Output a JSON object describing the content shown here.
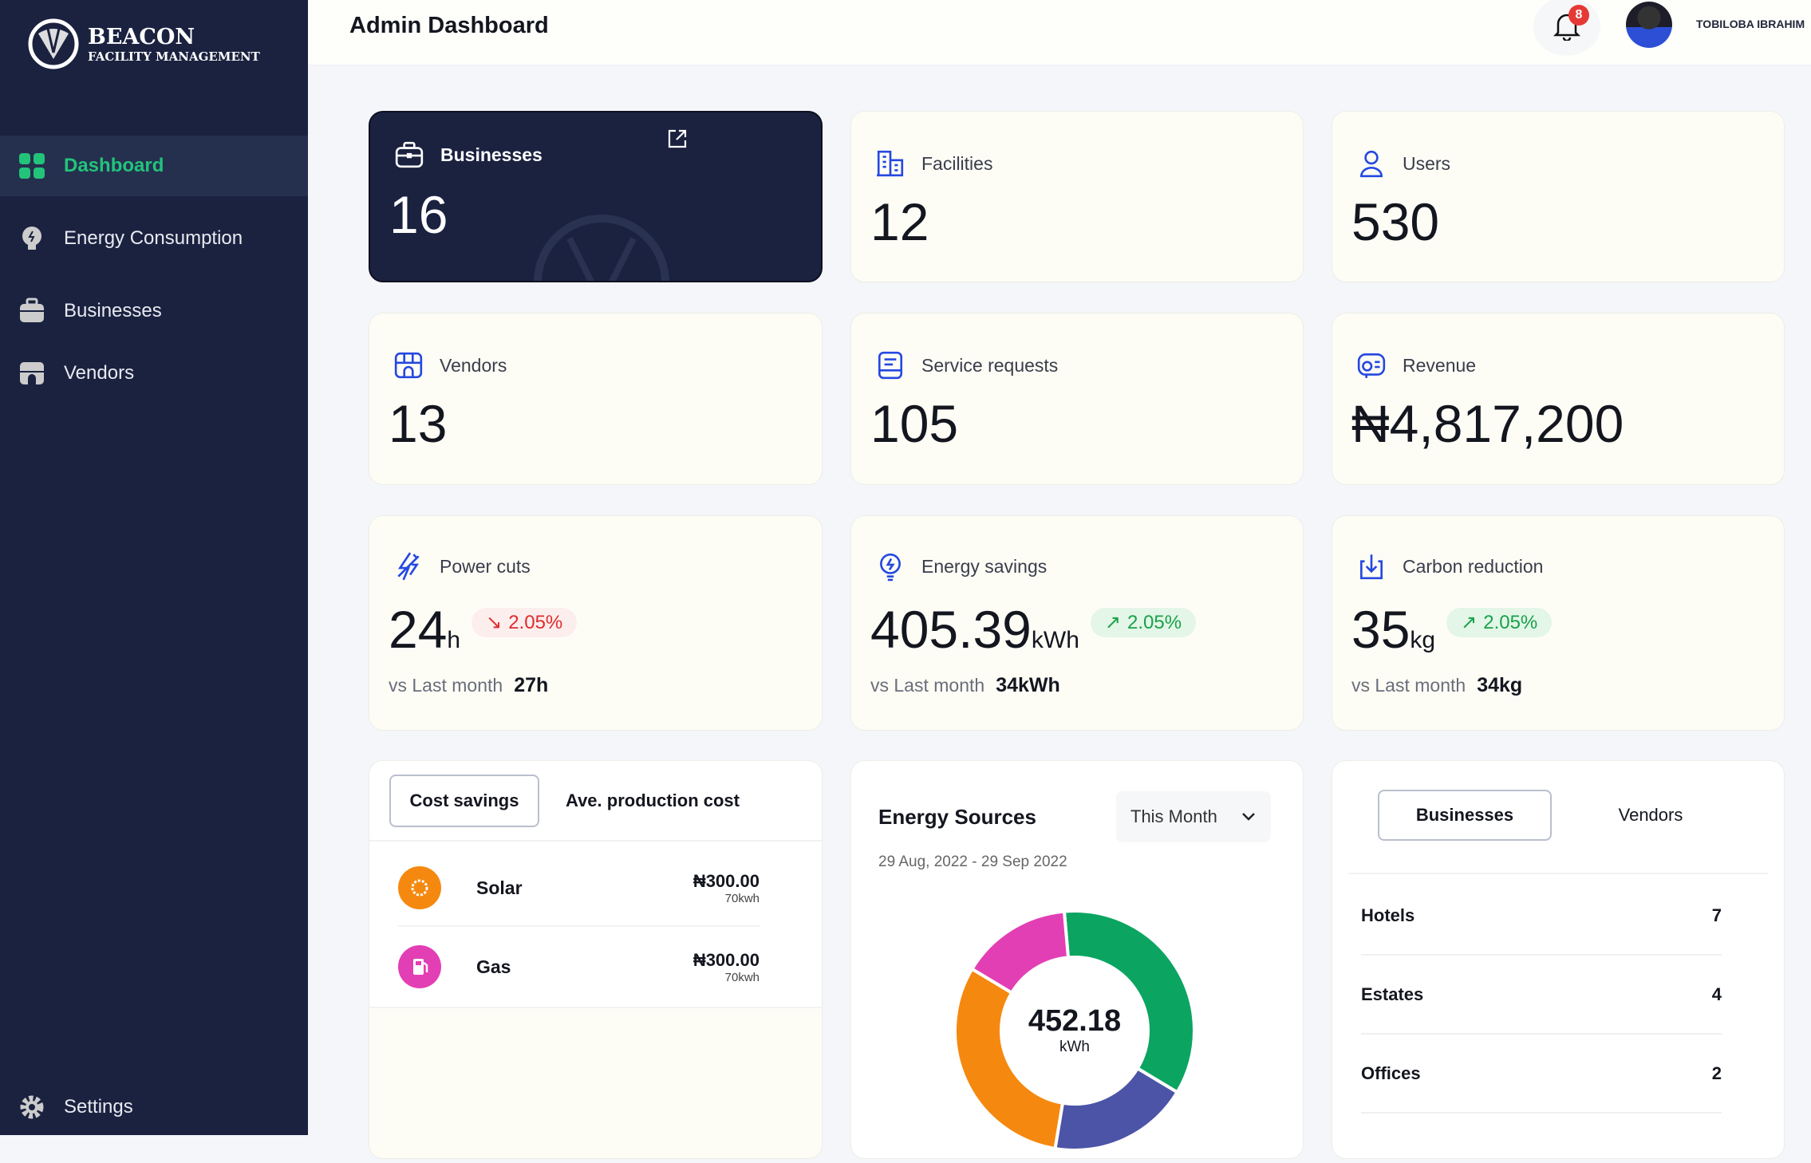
{
  "brand": {
    "name": "BEACON",
    "subtitle": "FACILITY MANAGEMENT"
  },
  "sidebar": {
    "items": [
      {
        "label": "Dashboard",
        "icon": "grid-icon",
        "active": true
      },
      {
        "label": "Energy Consumption",
        "icon": "bulb-icon"
      },
      {
        "label": "Businesses",
        "icon": "briefcase-icon"
      },
      {
        "label": "Vendors",
        "icon": "store-icon"
      }
    ],
    "settings": {
      "label": "Settings",
      "icon": "gear-icon"
    }
  },
  "header": {
    "title": "Admin Dashboard",
    "notifications": "8",
    "user": "TOBILOBA IBRAHIM"
  },
  "stats": [
    {
      "label": "Businesses",
      "value": "16"
    },
    {
      "label": "Facilities",
      "value": "12"
    },
    {
      "label": "Users",
      "value": "530"
    },
    {
      "label": "Vendors",
      "value": "13"
    },
    {
      "label": "Service requests",
      "value": "105"
    },
    {
      "label": "Revenue",
      "value": "₦4,817,200"
    }
  ],
  "metrics": [
    {
      "label": "Power cuts",
      "value": "24",
      "unit": "h",
      "change": "2.05%",
      "trend": "down",
      "vs_label": "vs Last month",
      "vs_value": "27h"
    },
    {
      "label": "Energy savings",
      "value": "405.39",
      "unit": "kWh",
      "change": "2.05%",
      "trend": "up",
      "vs_label": "vs Last month",
      "vs_value": "34kWh"
    },
    {
      "label": "Carbon reduction",
      "value": "35",
      "unit": "kg",
      "change": "2.05%",
      "trend": "up",
      "vs_label": "vs Last month",
      "vs_value": "34kg"
    }
  ],
  "cost": {
    "tabs": [
      "Cost savings",
      "Ave. production cost"
    ],
    "items": [
      {
        "name": "Solar",
        "amount": "₦300.00",
        "kwh": "70kwh",
        "color": "#f5890f"
      },
      {
        "name": "Gas",
        "amount": "₦300.00",
        "kwh": "70kwh",
        "color": "#e23fb5"
      }
    ]
  },
  "energy": {
    "title": "Energy Sources",
    "period": "This Month",
    "range": "29 Aug, 2022 - 29 Sep 2022",
    "total": "452.18",
    "unit": "kWh"
  },
  "chart_data": {
    "type": "pie",
    "donut": true,
    "center_label": "452.18 kWh",
    "slices": [
      {
        "percent": 35,
        "color": "#0ba561"
      },
      {
        "percent": 19,
        "color": "#4b54a6"
      },
      {
        "percent": 31,
        "color": "#f5890f"
      },
      {
        "percent": 15,
        "color": "#e23fb5"
      }
    ]
  },
  "breakdown": {
    "tabs": [
      "Businesses",
      "Vendors"
    ],
    "rows": [
      {
        "label": "Hotels",
        "count": "7"
      },
      {
        "label": "Estates",
        "count": "4"
      },
      {
        "label": "Offices",
        "count": "2"
      }
    ]
  }
}
